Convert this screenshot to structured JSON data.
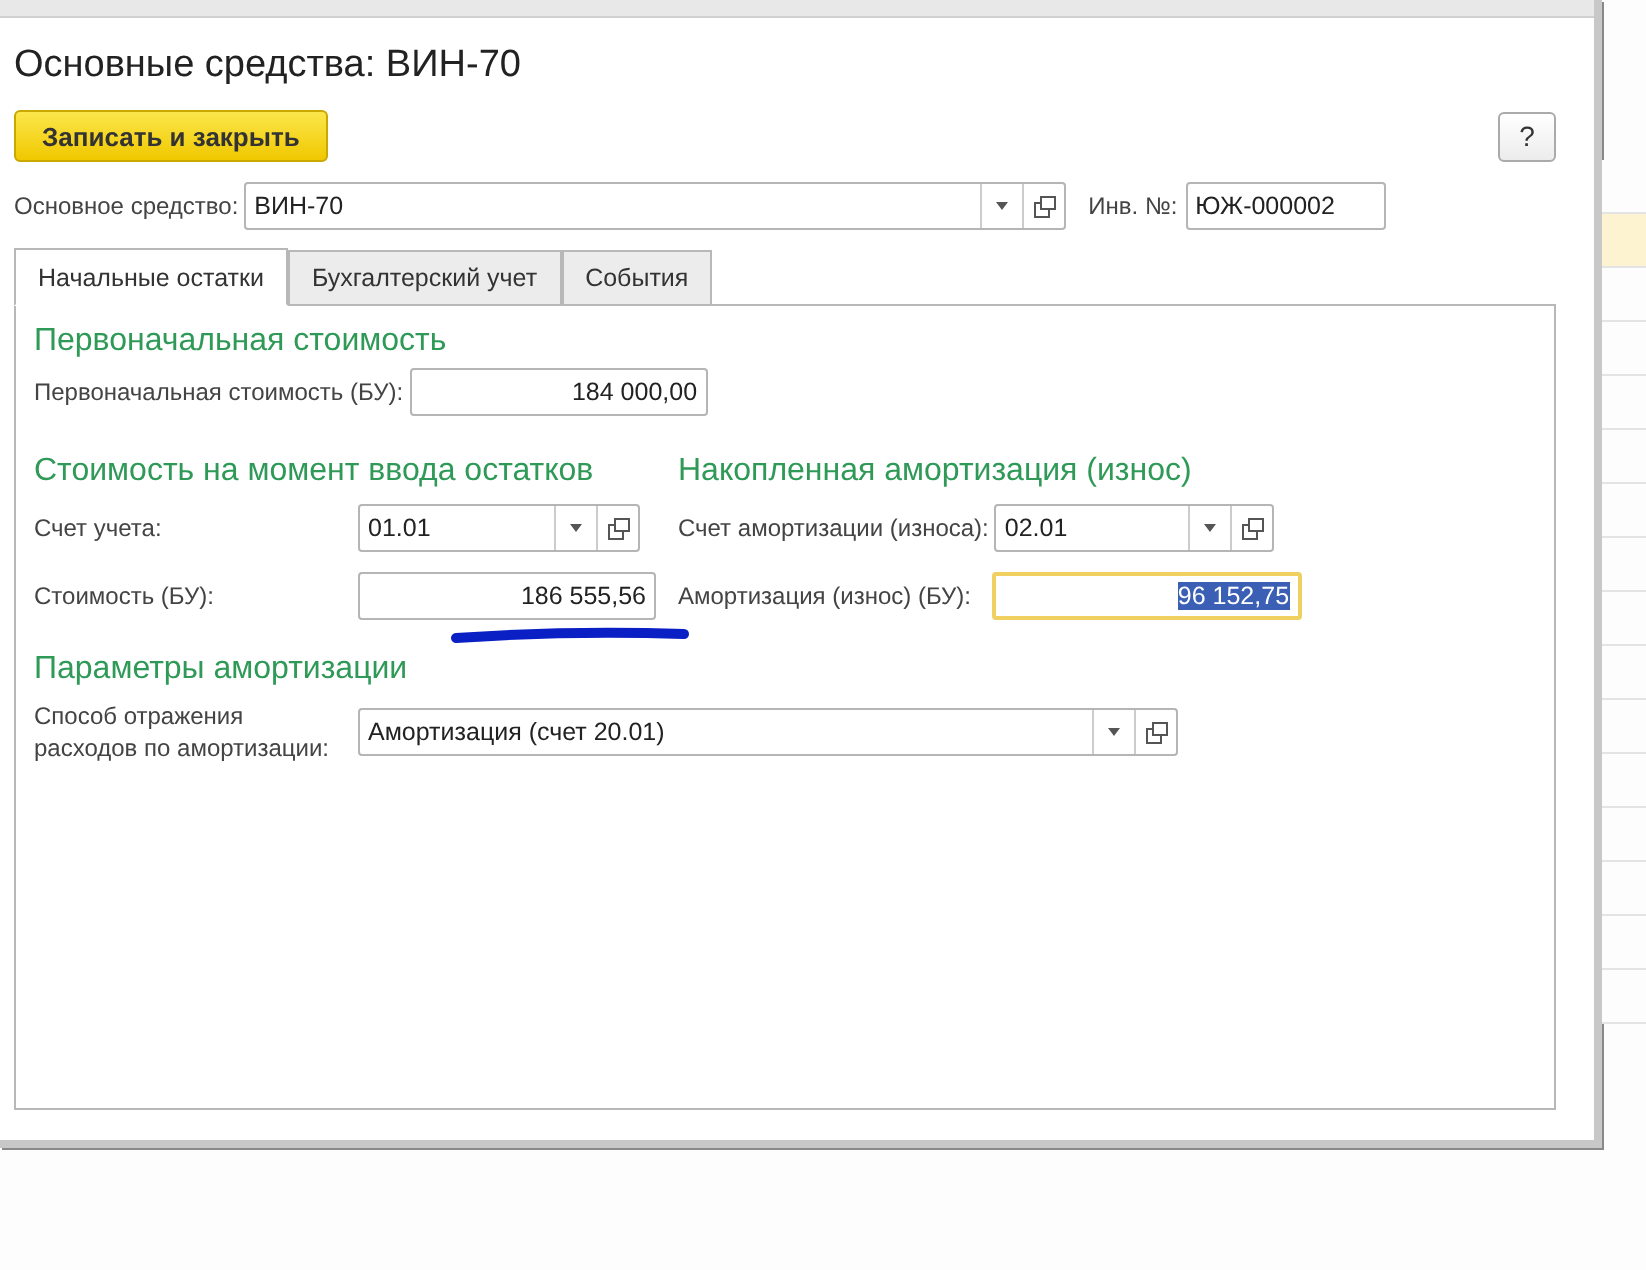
{
  "window": {
    "title": "Основные средства: ВИН-70"
  },
  "toolbar": {
    "save_button": "Записать и закрыть",
    "help_button": "?"
  },
  "header": {
    "asset_label": "Основное средство:",
    "asset_value": "ВИН-70",
    "inv_label": "Инв. №:",
    "inv_value": "ЮЖ-000002"
  },
  "tabs": [
    {
      "label": "Начальные остатки",
      "selected": true
    },
    {
      "label": "Бухгалтерский учет",
      "selected": false
    },
    {
      "label": "События",
      "selected": false
    }
  ],
  "initial_cost": {
    "heading": "Первоначальная стоимость",
    "label": "Первоначальная стоимость (БУ):",
    "value": "184 000,00"
  },
  "balance": {
    "heading": "Стоимость на момент ввода остатков",
    "account_label": "Счет учета:",
    "account_value": "01.01",
    "cost_label": "Стоимость (БУ):",
    "cost_value": "186 555,56"
  },
  "depreciation": {
    "heading": "Накопленная амортизация (износ)",
    "account_label": "Счет амортизации (износа):",
    "account_value": "02.01",
    "amount_label": "Амортизация (износ) (БУ):",
    "amount_value": "96 152,75",
    "amount_focused": true
  },
  "params": {
    "heading": "Параметры амортизации",
    "method_label": "Способ отражения расходов по амортизации:",
    "method_value": "Амортизация (счет 20.01)"
  }
}
